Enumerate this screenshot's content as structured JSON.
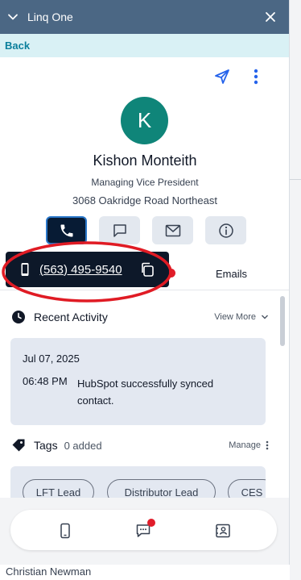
{
  "window": {
    "title": "Linq One"
  },
  "nav": {
    "back_label": "Back"
  },
  "contact": {
    "initial": "K",
    "name": "Kishon Monteith",
    "role": "Managing Vice President",
    "address": "3068 Oakridge Road Northeast"
  },
  "phone_popover": {
    "number": "(563) 495-9540"
  },
  "tabs": {
    "emails_label": "Emails"
  },
  "recent_activity": {
    "title": "Recent Activity",
    "view_more_label": "View More",
    "items": [
      {
        "date": "Jul 07, 2025",
        "time": "06:48 PM",
        "text": "HubSpot successfully synced contact."
      }
    ]
  },
  "tags": {
    "title": "Tags",
    "count_label": "0 added",
    "manage_label": "Manage",
    "items": [
      "LFT Lead",
      "Distributor Lead",
      "CES"
    ]
  },
  "footer": {
    "user_name": "Christian Newman"
  },
  "icons": {
    "header": [
      "chevron-down-icon",
      "close-icon"
    ],
    "top_actions": [
      "send-icon",
      "more-vertical-icon"
    ],
    "contact_actions": [
      "phone-icon",
      "chat-icon",
      "mail-icon",
      "info-icon"
    ],
    "bottom_nav": [
      "mobile-phone-icon",
      "messages-icon",
      "contact-card-icon"
    ]
  },
  "colors": {
    "header_bg": "#4b6784",
    "back_bar_bg": "#d9f1f5",
    "accent": "#0a7f9c",
    "avatar_bg": "#0f8579",
    "active_button_bg": "#071b34",
    "card_bg": "#e3e8f1",
    "notification_dot": "#e11d2a",
    "annotation_ellipse": "#e01b24"
  }
}
